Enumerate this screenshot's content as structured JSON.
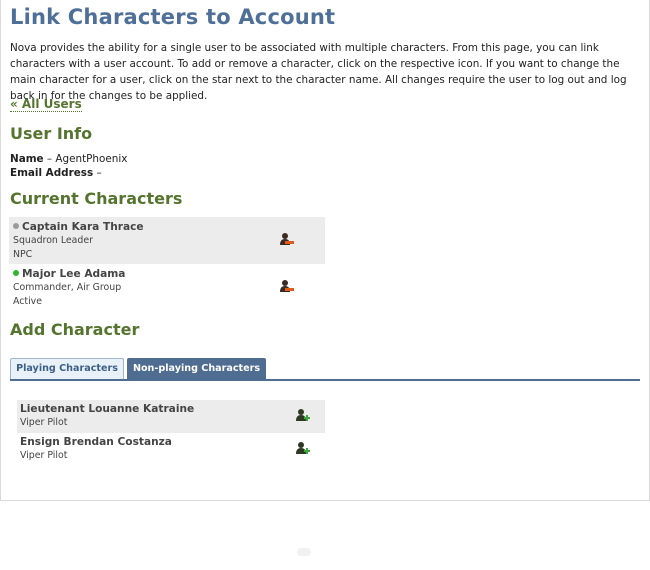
{
  "page": {
    "title": "Link Characters to Account",
    "intro": "Nova provides the ability for a single user to be associated with multiple characters. From this page, you can link characters with a user account. To add or remove a character, click on the respective icon. If you want to change the main character for a user, click on the star next to the character name. All changes require the user to log out and log back in for the changes to be applied.",
    "back_link": "« All Users"
  },
  "user_info": {
    "heading": "User Info",
    "name_label": "Name",
    "name_value": "– AgentPhoenix",
    "email_label": "Email Address",
    "email_value": "–"
  },
  "current_characters": {
    "heading": "Current Characters",
    "items": [
      {
        "name": "Captain Kara Thrace",
        "position": "Squadron Leader",
        "status": "NPC",
        "status_color": "#9a9a9a",
        "icon": "remove-user-icon"
      },
      {
        "name": "Major Lee Adama",
        "position": "Commander, Air Group",
        "status": "Active",
        "status_color": "#2fb52f",
        "icon": "remove-user-icon"
      }
    ]
  },
  "add_character": {
    "heading": "Add Character",
    "tabs": [
      {
        "label": "Playing Characters",
        "active": false
      },
      {
        "label": "Non-playing Characters",
        "active": true
      }
    ],
    "items": [
      {
        "name": "Lieutenant Louanne Katraine",
        "position": "Viper Pilot",
        "icon": "add-user-icon"
      },
      {
        "name": "Ensign Brendan Costanza",
        "position": "Viper Pilot",
        "icon": "add-user-icon"
      }
    ]
  },
  "colors": {
    "title": "#4e6f98",
    "heading": "#55752f",
    "tab_active": "#4f6d91",
    "remove_accent": "#e05a1a",
    "add_accent": "#3aa83a"
  }
}
